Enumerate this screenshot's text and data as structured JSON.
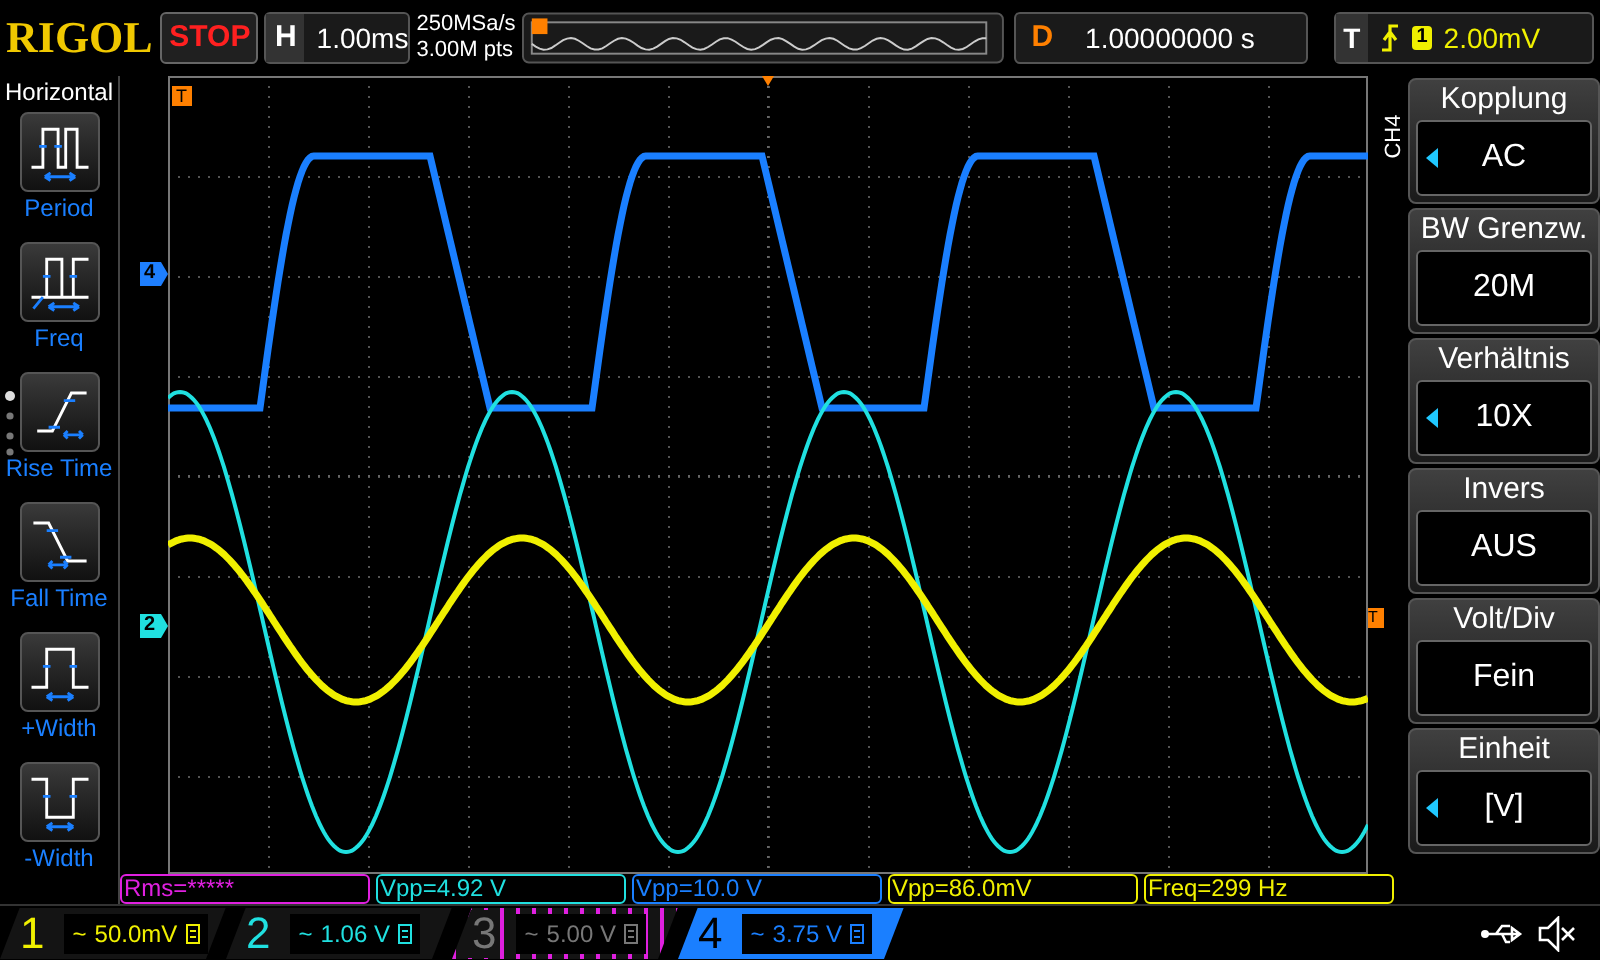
{
  "brand": "RIGOL",
  "run_state": "STOP",
  "horizontal": {
    "label": "H",
    "timebase": "1.00ms"
  },
  "acquisition": {
    "sample_rate": "250MSa/s",
    "memory_depth": "3.00M pts"
  },
  "delay": {
    "label": "D",
    "value": "1.00000000 s"
  },
  "trigger": {
    "label": "T",
    "source": "1",
    "level": "2.00mV"
  },
  "left_menu": {
    "title": "Horizontal",
    "items": [
      {
        "kind": "period",
        "label": "Period"
      },
      {
        "kind": "freq",
        "label": "Freq"
      },
      {
        "kind": "rise",
        "label": "Rise Time"
      },
      {
        "kind": "fall",
        "label": "Fall Time"
      },
      {
        "kind": "pwidth",
        "label": "+Width"
      },
      {
        "kind": "nwidth",
        "label": "-Width"
      }
    ]
  },
  "markers": [
    {
      "kind": "trigger_position",
      "label": "T"
    },
    {
      "kind": "channel",
      "label": "4",
      "color": "#1e7fff"
    },
    {
      "kind": "channel",
      "label": "2",
      "color": "#20e0e0"
    },
    {
      "kind": "trigger_level",
      "label": "T"
    }
  ],
  "traces": [
    {
      "kind": "trapezoid",
      "color": "#1a7fff"
    },
    {
      "kind": "sine",
      "color": "#20e0e0"
    },
    {
      "kind": "sine_small",
      "color": "#f0f000"
    }
  ],
  "side_menu": {
    "channel_label": "CH4",
    "items": [
      {
        "title": "Kopplung",
        "value": "AC",
        "adjustable": true
      },
      {
        "title": "BW Grenzw.",
        "value": "20M",
        "adjustable": false
      },
      {
        "title": "Verhältnis",
        "value": "10X",
        "adjustable": true
      },
      {
        "title": "Invers",
        "value": "AUS",
        "adjustable": false
      },
      {
        "title": "Volt/Div",
        "value": "Fein",
        "adjustable": false
      },
      {
        "title": "Einheit",
        "value": "[V]",
        "adjustable": true
      }
    ]
  },
  "measurements": [
    {
      "text": "Rms=*****",
      "color": "#e020e0"
    },
    {
      "text": "Vpp=4.92 V",
      "color": "#20e0e0"
    },
    {
      "text": "Vpp=10.0 V",
      "color": "#1a7fff"
    },
    {
      "text": "Vpp=86.0mV",
      "color": "#f0f000"
    },
    {
      "text": "Freq=299 Hz",
      "color": "#f0f000"
    }
  ],
  "channels": [
    {
      "label": "1",
      "coupling": "~",
      "scale": "50.0mV",
      "color": "#f0f000",
      "on": true,
      "selected": false
    },
    {
      "label": "2",
      "coupling": "~",
      "scale": "1.06 V",
      "color": "#20e0e0",
      "on": true,
      "selected": false
    },
    {
      "label": "3",
      "coupling": "~",
      "scale": "5.00 V",
      "color": "#e020e0",
      "on": false,
      "selected": false
    },
    {
      "label": "4",
      "coupling": "~",
      "scale": "3.75 V",
      "color": "#1a7fff",
      "on": true,
      "selected": true
    }
  ]
}
